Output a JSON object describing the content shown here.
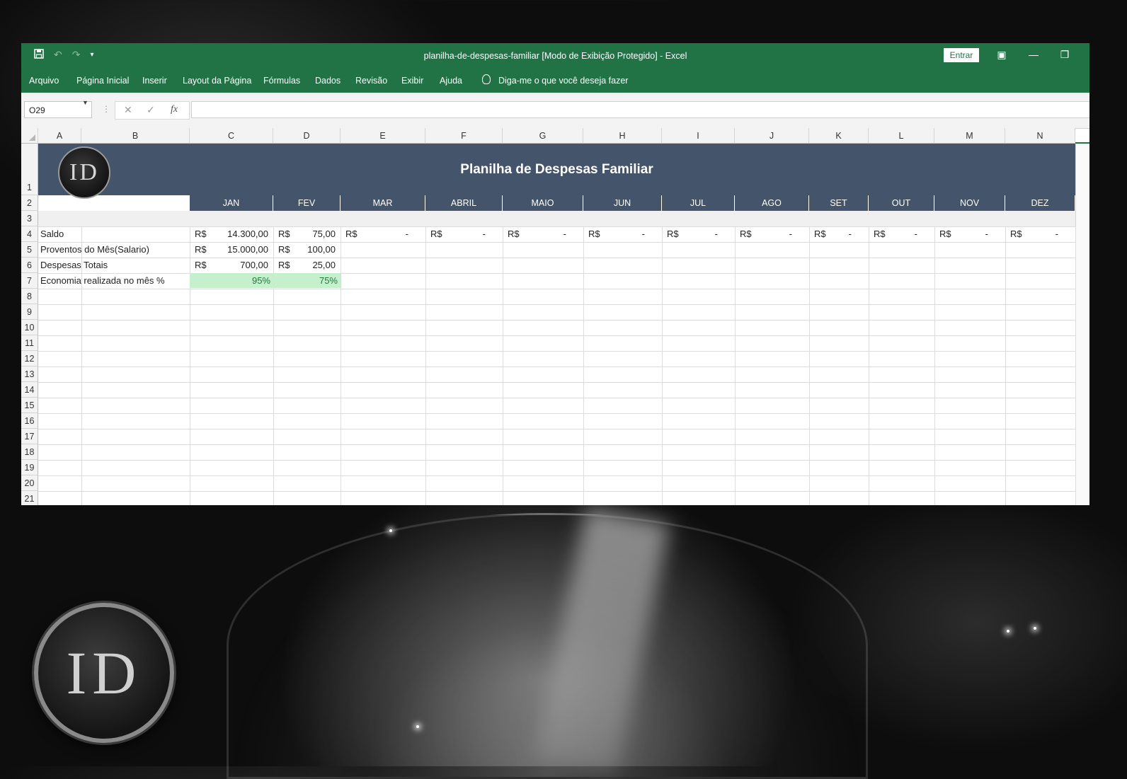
{
  "window": {
    "title": "planilha-de-despesas-familiar  [Modo de Exibição Protegido]  -  Excel",
    "signin": "Entrar"
  },
  "ribbon": {
    "tabs": [
      "Arquivo",
      "Página Inicial",
      "Inserir",
      "Layout da Página",
      "Fórmulas",
      "Dados",
      "Revisão",
      "Exibir",
      "Ajuda"
    ],
    "tellme": "Diga-me o que você deseja fazer"
  },
  "formula_bar": {
    "name_box": "O29",
    "fx": "fx",
    "value": ""
  },
  "columns": [
    "A",
    "B",
    "C",
    "D",
    "E",
    "F",
    "G",
    "H",
    "I",
    "J",
    "K",
    "L",
    "M",
    "N"
  ],
  "rows": [
    "1",
    "2",
    "3",
    "4",
    "5",
    "6",
    "7",
    "8",
    "9",
    "10",
    "11",
    "12",
    "13",
    "14",
    "15",
    "16",
    "17",
    "18",
    "19",
    "20",
    "21"
  ],
  "sheet": {
    "banner_title": "Planilha de Despesas Familiar",
    "logo_text": "ID",
    "months": [
      "JAN",
      "FEV",
      "MAR",
      "ABRIL",
      "MAIO",
      "JUN",
      "JUL",
      "AGO",
      "SET",
      "OUT",
      "NOV",
      "DEZ"
    ],
    "row_labels": [
      "Saldo",
      "Proventos do Mês(Salario)",
      "Despesas Totais",
      "Economia realizada no mês %"
    ],
    "currency": "R$",
    "dash": "-",
    "saldo": [
      "14.300,00",
      "75,00"
    ],
    "proventos": [
      "15.000,00",
      "100,00"
    ],
    "despesas": [
      "700,00",
      "25,00"
    ],
    "economia": [
      "95%",
      "75%"
    ]
  },
  "desktop": {
    "logo_text": "ID"
  },
  "colors": {
    "excel_green": "#217346",
    "header_blue": "#44546a",
    "good_fill": "#c6efce",
    "good_text": "#1f7a38"
  }
}
